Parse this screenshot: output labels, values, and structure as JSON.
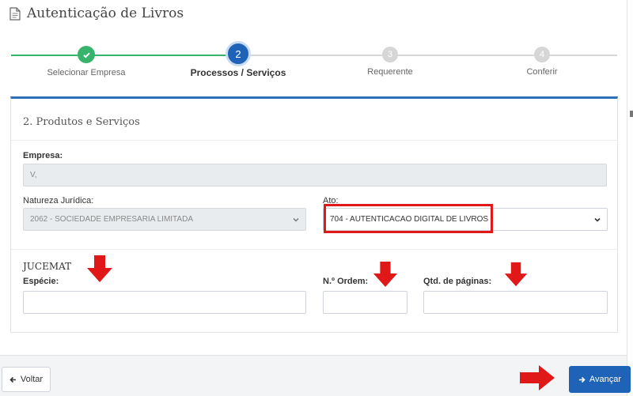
{
  "header": {
    "title": "Autenticação de Livros",
    "icon": "document-icon"
  },
  "stepper": {
    "steps": [
      {
        "number": "",
        "label": "Selecionar Empresa",
        "state": "done"
      },
      {
        "number": "2",
        "label": "Processos / Serviços",
        "state": "active"
      },
      {
        "number": "3",
        "label": "Requerente",
        "state": "pending"
      },
      {
        "number": "4",
        "label": "Conferir",
        "state": "pending"
      }
    ]
  },
  "form": {
    "section_title": "2. Produtos e Serviços",
    "empresa": {
      "label": "Empresa:",
      "value": "V,"
    },
    "natureza": {
      "label": "Natureza Jurídica:",
      "value": "2062 - SOCIEDADE EMPRESARIA LIMITADA"
    },
    "ato": {
      "label": "Ato:",
      "value": "704 - AUTENTICACAO DIGITAL DE LIVROS"
    },
    "group_title": "JUCEMAT",
    "especie": {
      "label": "Espécie:",
      "value": ""
    },
    "ordem": {
      "label": "N.º Ordem:",
      "value": ""
    },
    "paginas": {
      "label": "Qtd. de páginas:",
      "value": ""
    }
  },
  "footer": {
    "back_label": "Voltar",
    "next_label": "Avançar"
  },
  "colors": {
    "primary": "#1f63b8",
    "success": "#37b36b",
    "annotation": "#e01818"
  }
}
